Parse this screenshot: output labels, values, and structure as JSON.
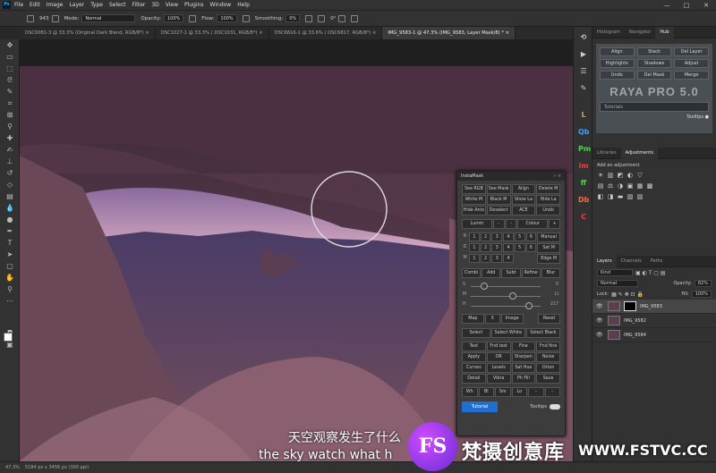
{
  "menubar": {
    "app_icon": "Ps",
    "items": [
      "File",
      "Edit",
      "Image",
      "Layer",
      "Type",
      "Select",
      "Filter",
      "3D",
      "View",
      "Plugins",
      "Window",
      "Help"
    ],
    "window_controls": [
      "—",
      "□",
      "✕"
    ]
  },
  "options": {
    "mode_label": "Mode:",
    "mode": "Normal",
    "opacity_label": "Opacity:",
    "opacity": "100%",
    "flow_label": "Flow:",
    "flow": "100%",
    "smoothing_label": "Smoothing:",
    "smoothing": "0%",
    "angle": "0°",
    "brush_size": "943"
  },
  "tabs": [
    {
      "label": "DSC0081-3 @ 33.3% (Original Dark Blend, RGB/8*) ×"
    },
    {
      "label": "DSC1027-1 @ 33.3% ( DSC1031, RGB/8*) ×"
    },
    {
      "label": "DSC6816-1 @ 33.6% ( DSC6817, RGB/8*) ×"
    },
    {
      "label": "IMG_9583-1 @ 47.3% (IMG_9583, Layer Mask/8) * ×"
    }
  ],
  "status": {
    "zoom": "47.3%",
    "doc": "5184 px x 3456 px (300 ppi)"
  },
  "panel_tabs": {
    "top": [
      "Histogram",
      "Navigator",
      "Hub"
    ],
    "mid": [
      "Libraries",
      "Adjustments"
    ],
    "layers": [
      "Layers",
      "Channels",
      "Paths"
    ]
  },
  "raya": {
    "buttons": [
      "Align",
      "Stack",
      "Del Layer",
      "Highlights",
      "Shadows",
      "Adjust",
      "Undo",
      "Del Mask",
      "Merge"
    ],
    "title": "RAYA PRO 5.0",
    "tutorials": "Tutorials",
    "tooltips": "Tooltips"
  },
  "side_icons": [
    {
      "g": "L",
      "c": "#c8a070"
    },
    {
      "g": "Qb",
      "c": "#3aa0ff"
    },
    {
      "g": "Pm",
      "c": "#3adf3a"
    },
    {
      "g": "im",
      "c": "#ff3a3a"
    },
    {
      "g": "ff",
      "c": "#3adf3a"
    },
    {
      "g": "Db",
      "c": "#ff6a3a"
    },
    {
      "g": "C",
      "c": "#ff3a3a"
    }
  ],
  "adjustments": {
    "add_label": "Add an adjustment",
    "row1": [
      "☀",
      "▥",
      "◩",
      "◐",
      "▽"
    ],
    "row2": [
      "▤",
      "⚖",
      "◑",
      "▣",
      "▦",
      "▩"
    ],
    "row3": [
      "◧",
      "◨",
      "▬",
      "▧",
      "▨"
    ]
  },
  "layers": {
    "kind": "Kind",
    "blend": "Normal",
    "opacity_label": "Opacity:",
    "opacity": "82%",
    "lock_label": "Lock:",
    "fill_label": "Fill:",
    "fill": "100%",
    "items": [
      {
        "name": "IMG_9583",
        "mask": true,
        "active": true
      },
      {
        "name": "IMG_9582",
        "mask": false,
        "active": false
      },
      {
        "name": "IMG_9584",
        "mask": false,
        "active": false
      }
    ]
  },
  "instamask": {
    "title": "InstaMask",
    "close": "» ≡",
    "top": [
      "See RGB",
      "See Mask",
      "Align",
      "Delete M",
      "White M",
      "Black M",
      "Show La",
      "Hide La",
      "Hide Ants",
      "Deselect",
      "ACE",
      "Undo"
    ],
    "lumin": "Lumin",
    "colour": "Colour",
    "minus": "-",
    "plus": "+",
    "grid_rows": [
      {
        "k": "R",
        "v": [
          "1",
          "2",
          "3",
          "4",
          "5",
          "6"
        ],
        "a": "Manual"
      },
      {
        "k": "D",
        "v": [
          "1",
          "2",
          "3",
          "4",
          "5",
          "6"
        ],
        "a": "Sat M"
      },
      {
        "k": "M",
        "v": [
          "1",
          "2",
          "3",
          "4"
        ],
        "a": "Edge M"
      }
    ],
    "ops": [
      "Combi",
      "Add",
      "Subt",
      "Refine",
      "Blur"
    ],
    "sliders": [
      {
        "l": "S",
        "v": "0",
        "p": 0.15
      },
      {
        "l": "M",
        "v": "LI",
        "p": 0.6
      },
      {
        "l": "H",
        "v": "217",
        "p": 0.85
      }
    ],
    "map": [
      "Map",
      "X",
      "Image",
      "Reset"
    ],
    "sel": [
      "Select",
      "Select White",
      "Select Black"
    ],
    "actions": [
      "Test",
      "Fnd test",
      "Fine",
      "Fnd fine",
      "Apply",
      "OR",
      "Sharpen",
      "Noise",
      "Curves",
      "Levels",
      "Sat Hue",
      "Orton",
      "Detail",
      "Vibra",
      "Ph Fill",
      "Save",
      "Wh",
      "Bl",
      "Sm",
      "Lo",
      "-",
      "-"
    ],
    "tutorial": "Tutorial",
    "tooltips": "Tooltips"
  },
  "subtitles": {
    "zh": "天空观察发生了什么",
    "en": "the sky watch what h"
  },
  "watermark": {
    "logo": "FS",
    "cn": "梵摄创意库",
    "url": "WWW.FSTVC.CC"
  }
}
